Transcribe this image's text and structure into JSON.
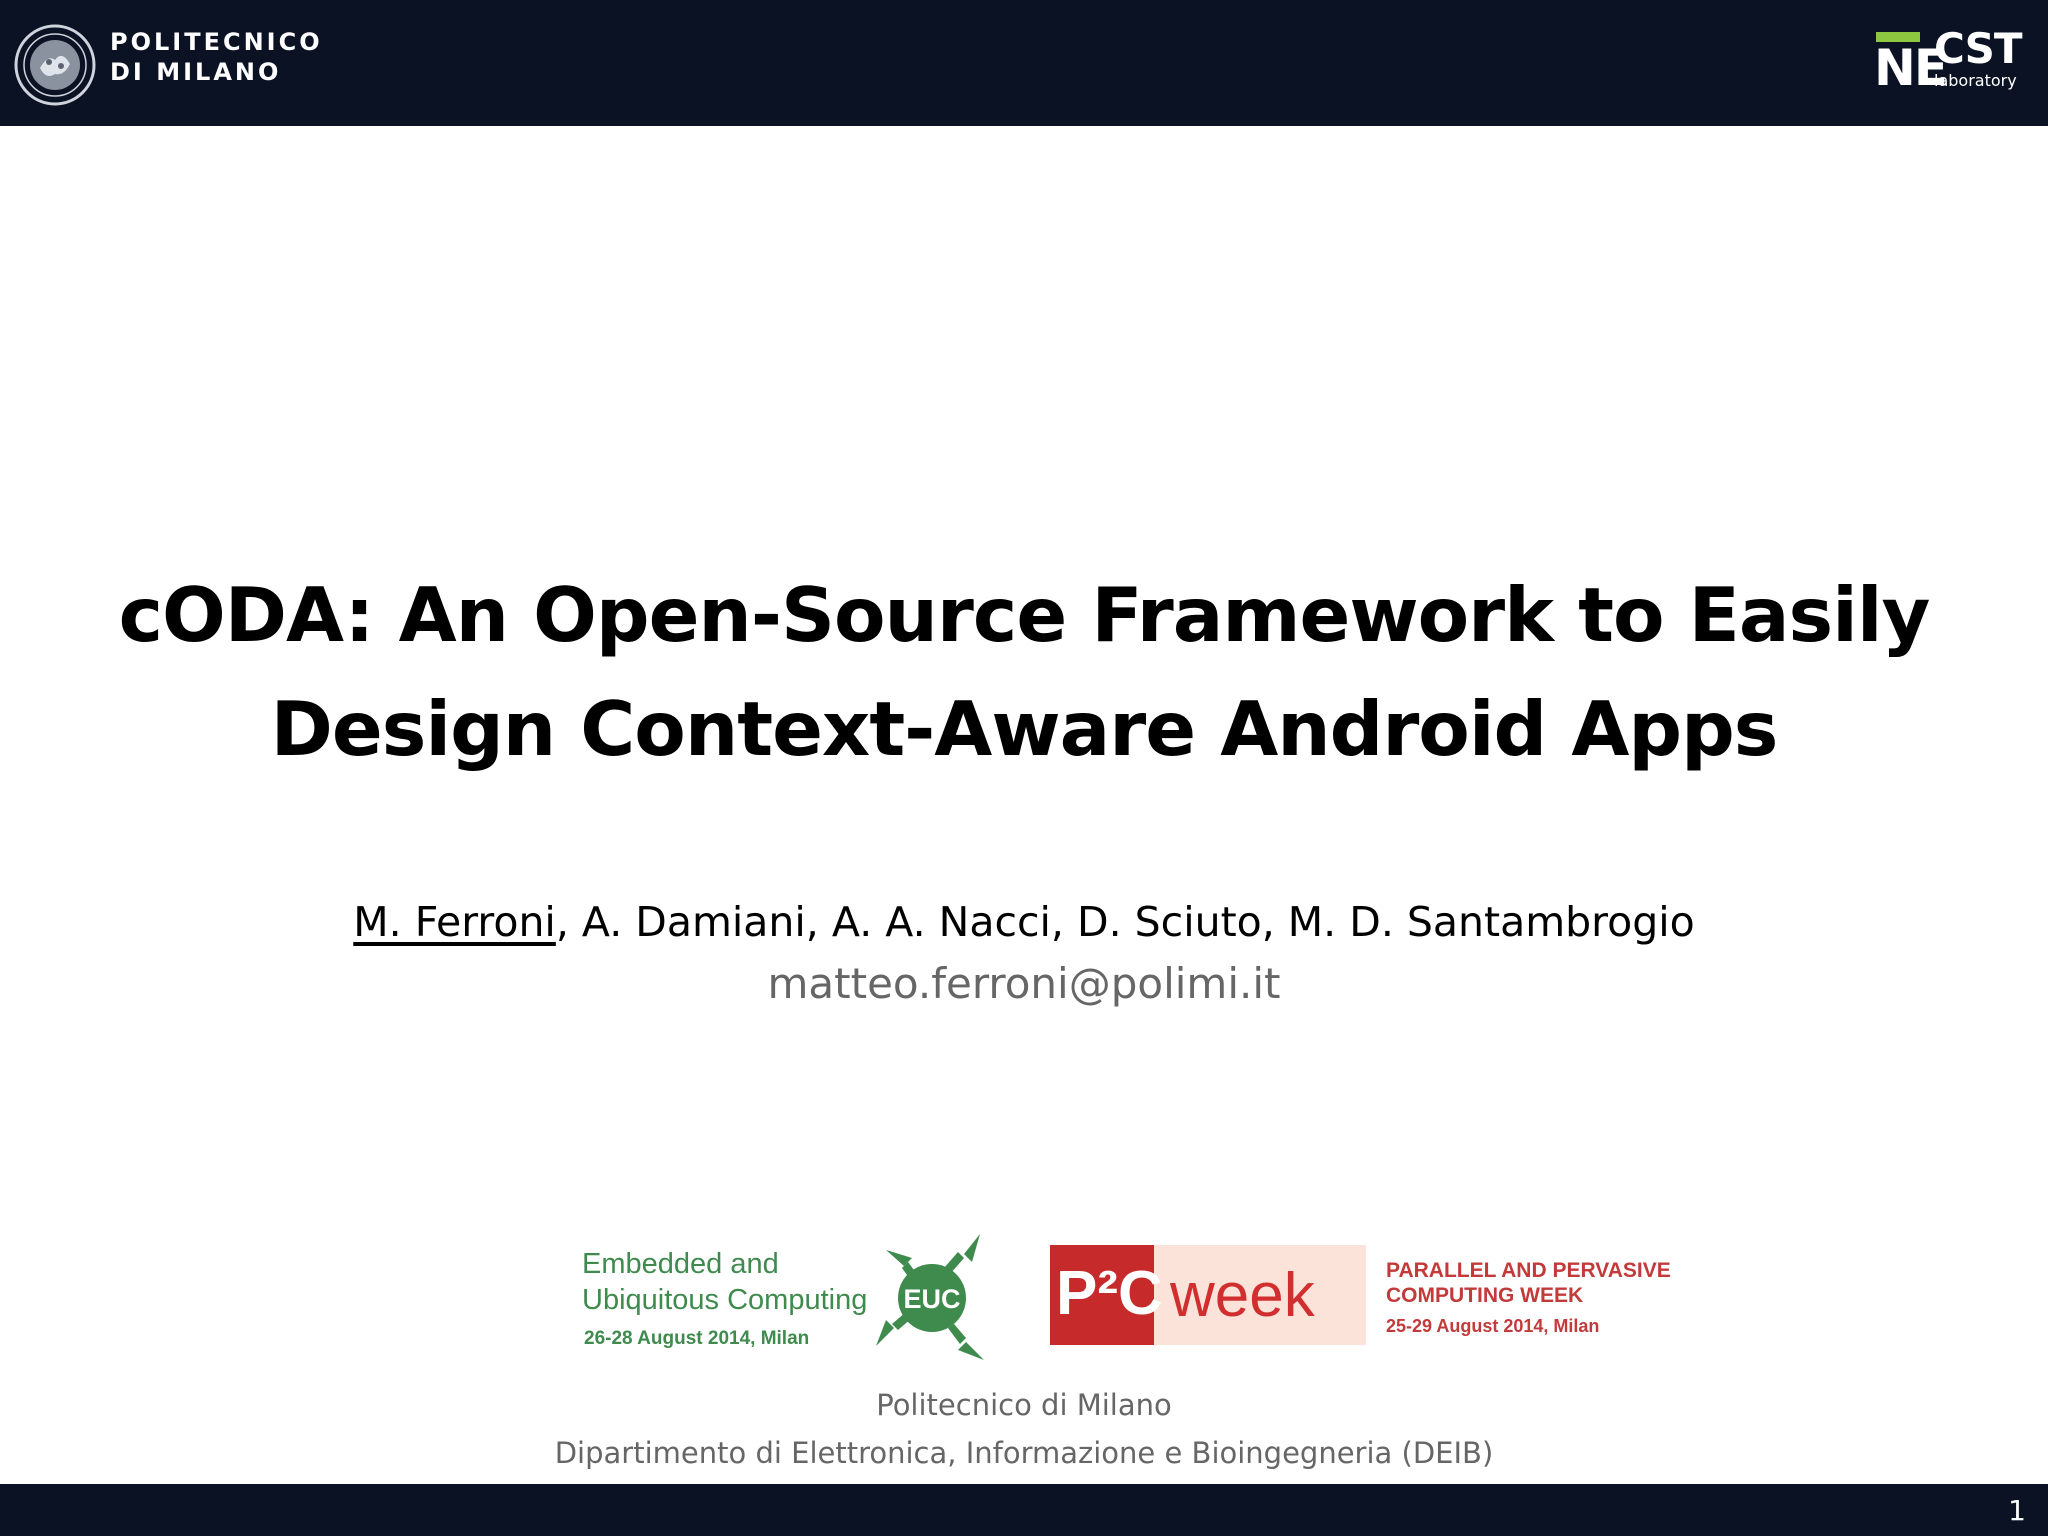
{
  "header": {
    "university_line1": "POLITECNICO",
    "university_line2": "DI MILANO",
    "lab_logo_text_ne": "NE",
    "lab_logo_text_cst": "CST",
    "lab_logo_text_lab": "laboratory"
  },
  "slide": {
    "title_line1": "cODA: An Open-Source Framework to Easily",
    "title_line2": "Design Context-Aware Android Apps",
    "author_main": "M. Ferroni",
    "authors_rest": ", A. Damiani, A. A. Nacci, D. Sciuto, M. D. Santambrogio",
    "email": "matteo.ferroni@polimi.it"
  },
  "conferences": {
    "euc": {
      "line1": "Embedded and",
      "line2": "Ubiquitous Computing",
      "date": "26-28 August 2014, Milan",
      "badge": "EUC",
      "color": "#3f8b4e"
    },
    "p2c": {
      "logo": "P²C",
      "week": "week",
      "line1": "PARALLEL AND PERVASIVE",
      "line2": "COMPUTING WEEK",
      "date": "25-29 August 2014, Milan",
      "color": "#c62a2a"
    }
  },
  "footer": {
    "affiliation1": "Politecnico di Milano",
    "affiliation2": "Dipartimento di Elettronica, Informazione e Bioingegneria (DEIB)",
    "page_number": "1"
  },
  "colors": {
    "bar": "#0b1224",
    "necst_green": "#8dc63f",
    "muted_text": "#666666"
  }
}
